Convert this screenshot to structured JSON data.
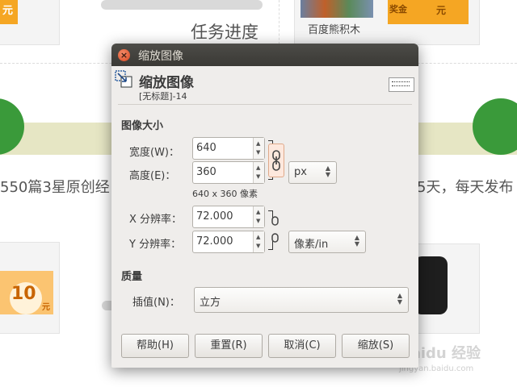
{
  "background": {
    "task_progress": "任务进度",
    "toy_label": "百度熊积木",
    "article_text_left": "550篇3星原创经",
    "article_text_right": "5天，每天发布",
    "tag_top_left": "元",
    "tag_top_right_a": "奖金",
    "tag_top_right_b": "元",
    "tag_bottom_left_amount": "10",
    "tag_bottom_left_unit": "元",
    "watermark": "Baidu 经验",
    "watermark_url": "jingyan.baidu.com"
  },
  "dialog": {
    "window_title": "缩放图像",
    "header_title": "缩放图像",
    "header_subtitle": "[无标题]-14",
    "image_size": {
      "section_title": "图像大小",
      "width_label": "宽度(W)：",
      "width_value": "640",
      "height_label": "高度(E)：",
      "height_value": "360",
      "unit": "px",
      "size_hint": "640 x 360 像素",
      "x_res_label": "X 分辨率：",
      "x_res_value": "72.000",
      "y_res_label": "Y 分辨率：",
      "y_res_value": "72.000",
      "res_unit": "像素/in"
    },
    "quality": {
      "section_title": "质量",
      "interp_label": "插值(N)：",
      "interp_value": "立方"
    },
    "buttons": {
      "help": "帮助(H)",
      "reset": "重置(R)",
      "cancel": "取消(C)",
      "scale": "缩放(S)"
    },
    "icons": {
      "close": "close-icon",
      "scale": "scale-image-icon",
      "chain": "chain-link-icon",
      "chain_broken": "chain-broken-icon"
    }
  }
}
